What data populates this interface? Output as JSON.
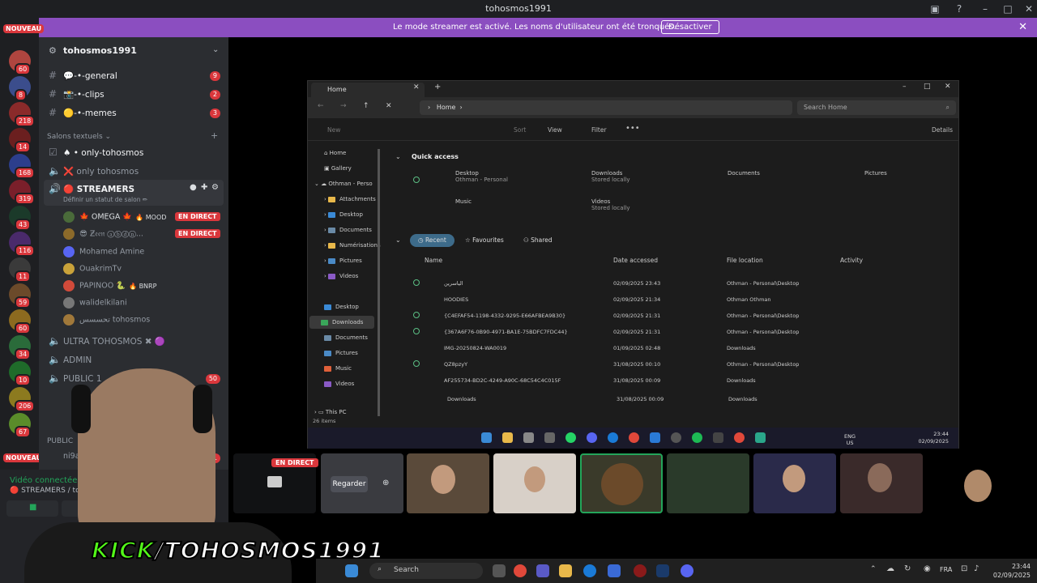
{
  "window": {
    "title": "tohosmos1991"
  },
  "banner": {
    "message": "Le mode streamer est activé. Les noms d'utilisateur ont été tronqués.",
    "button": "Désactiver"
  },
  "rail": {
    "nouveau_label": "NOUVEAU",
    "badges": [
      "60",
      "8",
      "218",
      "14",
      "168",
      "319",
      "43",
      "116",
      "11",
      "59",
      "60",
      "34",
      "10",
      "206",
      "67"
    ]
  },
  "sidebar": {
    "server_name": "tohosmos1991",
    "channels": [
      {
        "name": "💬-•-general",
        "badge": "9"
      },
      {
        "name": "📸-•-clips",
        "badge": "2"
      },
      {
        "name": "🟡-•-memes",
        "badge": "3"
      }
    ],
    "category_text": "Salons textuels",
    "text_channels": [
      {
        "name": "♠ • only-tohosmos"
      },
      {
        "name": "❌ only tohosmos"
      }
    ],
    "voice_active": {
      "name": "🔴 STREAMERS",
      "status": "Définir un statut de salon ✏"
    },
    "voice_users": [
      {
        "name": "🍁 OMEGA 🍁",
        "tag": "🔥 MOOD",
        "live": "EN DIRECT"
      },
      {
        "name": "😎 Ƶ𝔢𝔢𝔫 ⓐⓑⓓⓝ...",
        "tag": "",
        "live": "EN DIRECT"
      },
      {
        "name": "Mohamed Amine",
        "tag": "",
        "live": ""
      },
      {
        "name": "OuakrimTv",
        "tag": "",
        "live": ""
      },
      {
        "name": "PAPINOO 🐍",
        "tag": "🔥 BNRP",
        "live": ""
      },
      {
        "name": "walidelkilani",
        "tag": "",
        "live": ""
      },
      {
        "name": "تحسسس tohosmos",
        "tag": "",
        "live": ""
      }
    ],
    "other_channels": [
      {
        "name": "ULTRA TOHOSMOS ✖ 🟣"
      },
      {
        "name": "ADMIN"
      },
      {
        "name": "PUBLIC 1",
        "badge": "50"
      }
    ],
    "public_label": "PUBLIC",
    "public_user": "ni9a",
    "public_badge": "1"
  },
  "voice_panel": {
    "connected": "Vidéo connectée",
    "location": "🔴 STREAMERS / tohosmos1991"
  },
  "explorer": {
    "tab": "Home",
    "breadcrumb": "Home",
    "search_placeholder": "Search Home",
    "toolbar": {
      "new": "New",
      "sort": "Sort",
      "view": "View",
      "filter": "Filter",
      "details": "Details"
    },
    "side_items": [
      "Home",
      "Gallery",
      "Othman - Perso",
      "Attachments",
      "Desktop",
      "Documents",
      "Numérisations",
      "Pictures",
      "Videos",
      "Desktop",
      "Downloads",
      "Documents",
      "Pictures",
      "Music",
      "Videos",
      "This PC"
    ],
    "quick_access_title": "Quick access",
    "quick_access": [
      {
        "name": "Desktop",
        "sub": "Othman - Personal"
      },
      {
        "name": "Downloads",
        "sub": "Stored locally"
      },
      {
        "name": "Documents",
        "sub": ""
      },
      {
        "name": "Pictures",
        "sub": ""
      },
      {
        "name": "Music",
        "sub": ""
      },
      {
        "name": "Videos",
        "sub": "Stored locally"
      }
    ],
    "pills": [
      "Recent",
      "Favourites",
      "Shared"
    ],
    "columns": [
      "Name",
      "Date accessed",
      "File location",
      "Activity"
    ],
    "files": [
      {
        "name": "الياسرين",
        "date": "02/09/2025 23:43",
        "location": "Othman - Personal\\Desktop"
      },
      {
        "name": "HOODIES",
        "date": "02/09/2025 21:34",
        "location": "Othman Othman"
      },
      {
        "name": "{C4EFAF54-1198-4332-9295-E66AFBEA9B30}",
        "date": "02/09/2025 21:31",
        "location": "Othman - Personal\\Desktop"
      },
      {
        "name": "{367A6F76-0B90-4971-BA1E-75BDFC7FDC44}",
        "date": "02/09/2025 21:31",
        "location": "Othman - Personal\\Desktop"
      },
      {
        "name": "IMG-20250824-WA0019",
        "date": "01/09/2025 02:48",
        "location": "Downloads"
      },
      {
        "name": "QZ8pzyY",
        "date": "31/08/2025 00:10",
        "location": "Othman - Personal\\Desktop"
      },
      {
        "name": "AF255734-BD2C-4249-A90C-68C54C4C015F",
        "date": "31/08/2025 00:09",
        "location": "Downloads"
      },
      {
        "name": "Downloads",
        "date": "31/08/2025 00:09",
        "location": "Downloads"
      }
    ],
    "status": "26 items",
    "tray": {
      "lang1": "ENG",
      "lang2": "US",
      "time": "23:44",
      "date": "02/09/2025"
    }
  },
  "tiles": {
    "live_badge": "EN DIRECT",
    "watch_label": "Regarder"
  },
  "overlay": {
    "kick": "KICK",
    "handle": "/TOHOSMOS1991"
  },
  "taskbar": {
    "search": "Search",
    "lang": "FRA",
    "time": "23:44",
    "date": "02/09/2025"
  }
}
